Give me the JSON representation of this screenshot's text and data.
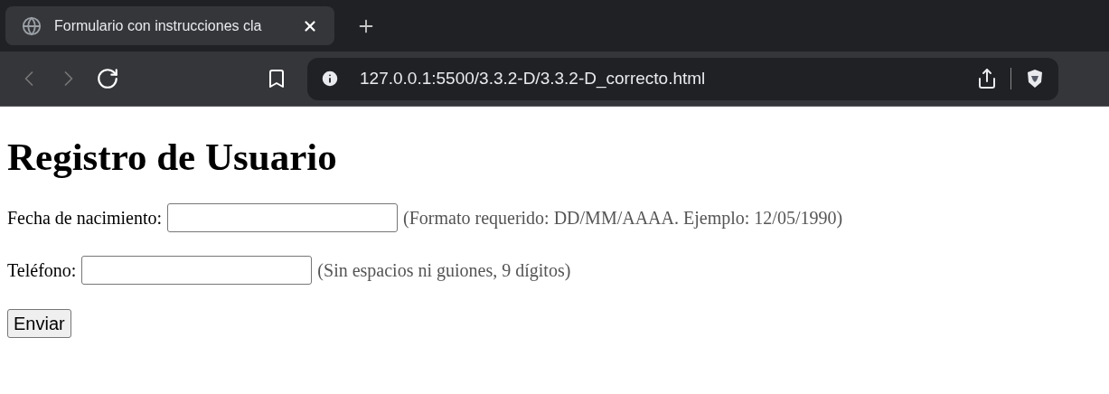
{
  "browser": {
    "tab": {
      "title": "Formulario con instrucciones cla",
      "selected": true
    },
    "url": "127.0.0.1:5500/3.3.2-D/3.3.2-D_correcto.html"
  },
  "page": {
    "heading": "Registro de Usuario",
    "fields": [
      {
        "label": "Fecha de nacimiento:",
        "hint": "(Formato requerido: DD/MM/AAAA. Ejemplo: 12/05/1990)"
      },
      {
        "label": "Teléfono:",
        "hint": "(Sin espacios ni guiones, 9 dígitos)"
      }
    ],
    "submit": "Enviar"
  }
}
